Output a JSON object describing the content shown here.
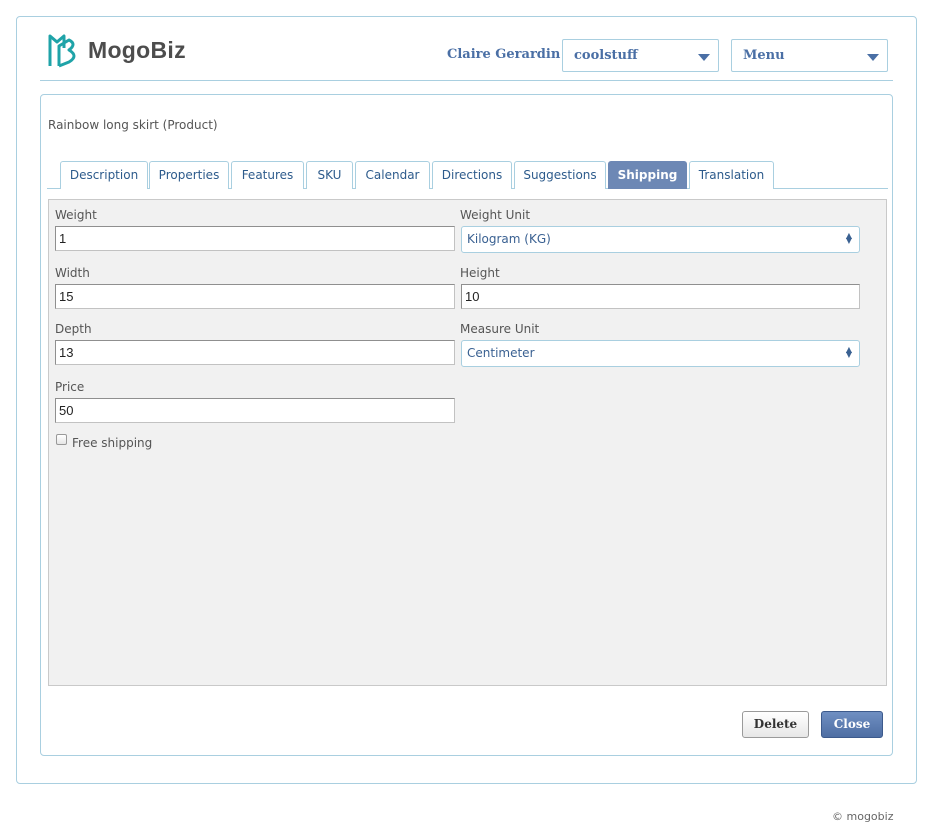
{
  "header": {
    "logo_text": "MogoBiz",
    "user_name": "Claire Gerardin",
    "store_select": "coolstuff",
    "menu_select": "Menu"
  },
  "page": {
    "title": "Rainbow long skirt (Product)"
  },
  "tabs": [
    {
      "label": "Description",
      "active": false
    },
    {
      "label": "Properties",
      "active": false
    },
    {
      "label": "Features",
      "active": false
    },
    {
      "label": "SKU",
      "active": false
    },
    {
      "label": "Calendar",
      "active": false
    },
    {
      "label": "Directions",
      "active": false
    },
    {
      "label": "Suggestions",
      "active": false
    },
    {
      "label": "Shipping",
      "active": true
    },
    {
      "label": "Translation",
      "active": false
    }
  ],
  "form": {
    "weight_label": "Weight",
    "weight_value": "1",
    "weight_unit_label": "Weight Unit",
    "weight_unit_value": "Kilogram (KG)",
    "width_label": "Width",
    "width_value": "15",
    "height_label": "Height",
    "height_value": "10",
    "depth_label": "Depth",
    "depth_value": "13",
    "measure_unit_label": "Measure Unit",
    "measure_unit_value": "Centimeter",
    "price_label": "Price",
    "price_value": "50",
    "free_shipping_label": "Free shipping",
    "free_shipping_checked": false
  },
  "buttons": {
    "delete_label": "Delete",
    "close_label": "Close"
  },
  "footer": {
    "copyright": "© mogobiz"
  },
  "colors": {
    "accent": "#4a6fa5",
    "border": "#a9cfe0",
    "logo_icon": "#1fa3a8",
    "active_tab": "#6d88b5"
  }
}
